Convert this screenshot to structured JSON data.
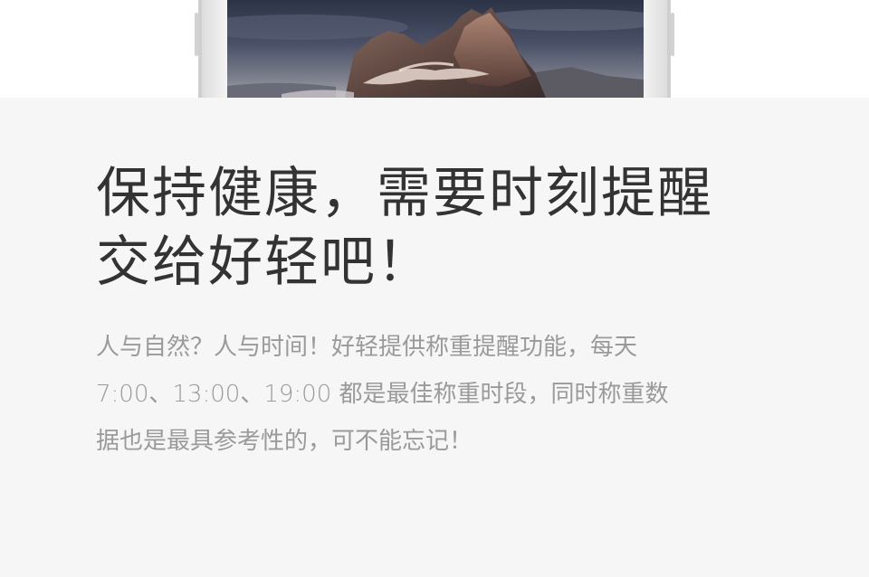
{
  "headline": {
    "line1": "保持健康，需要时刻提醒",
    "line2": "交给好轻吧！"
  },
  "body": {
    "line1": "人与自然？人与时间！好轻提供称重提醒功能，每天",
    "line2": "7:00、13:00、19:00 都是最佳称重时段，同时称重数",
    "line3": "据也是最具参考性的，可不能忘记！"
  },
  "colors": {
    "background": "#f6f6f6",
    "headline": "#333333",
    "body": "#9a9a9a"
  }
}
